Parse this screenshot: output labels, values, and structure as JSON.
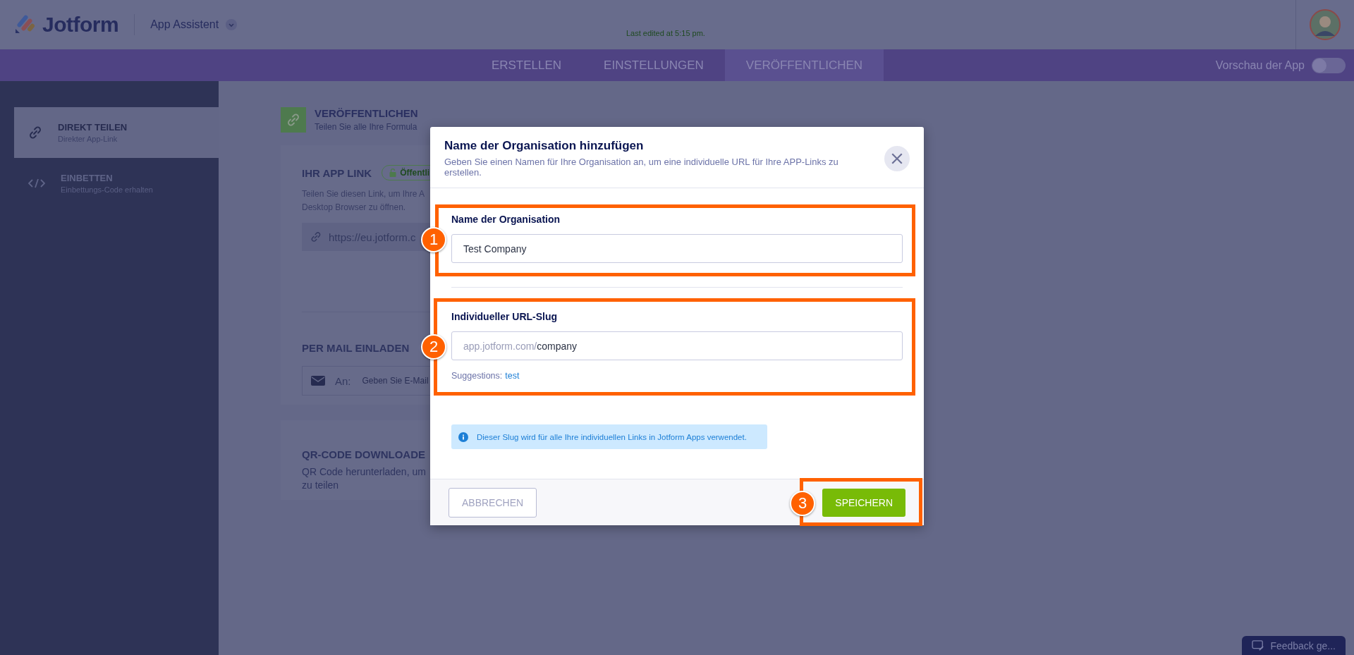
{
  "header": {
    "logo": "Jotform",
    "app_name": "App Assistent",
    "last_edited": "Last edited at 5:15 pm."
  },
  "nav": {
    "tabs": [
      {
        "label": "ERSTELLEN",
        "selected": false
      },
      {
        "label": "EINSTELLUNGEN",
        "selected": false
      },
      {
        "label": "VERÖFFENTLICHEN",
        "selected": true
      }
    ],
    "preview": {
      "label": "Vorschau der App",
      "on": false
    }
  },
  "sidebar": {
    "items": [
      {
        "kind": "link",
        "title": "DIREKT TEILEN",
        "subtitle": "Direkter App-Link",
        "selected": true
      },
      {
        "kind": "code",
        "title": "EINBETTEN",
        "subtitle": "Einbettungs-Code erhalten",
        "selected": false
      }
    ]
  },
  "main": {
    "title": "VERÖFFENTLICHEN",
    "subtitle": "Teilen Sie alle Ihre Formula",
    "app_link": {
      "heading": "IHR APP LINK",
      "badge": "Öffentli",
      "description": [
        "Teilen Sie diesen Link, um Ihre A",
        "Desktop Browser zu öffnen."
      ],
      "url": "https://eu.jotform.c"
    },
    "mail": {
      "heading": "PER MAIL EINLADEN",
      "to_label": "An:",
      "placeholder": "Geben Sie E-Mail"
    },
    "qr": {
      "heading": "QR-CODE DOWNLOADE",
      "description": [
        "QR Code herunterladen, um",
        "zu teilen"
      ]
    }
  },
  "modal": {
    "title": "Name der Organisation hinzufügen",
    "subtitle": "Geben Sie einen Namen für Ihre Organisation an, um eine individuelle URL für Ihre APP-Links zu erstellen.",
    "org_field": {
      "label": "Name der Organisation",
      "value": "Test Company"
    },
    "slug_field": {
      "label": "Individueller URL-Slug",
      "prefix": "app.jotform.com/",
      "value": "company",
      "suggestions_label": "Suggestions:",
      "suggestion": "test"
    },
    "info": "Dieser Slug wird für alle Ihre individuellen Links in Jotform Apps verwendet.",
    "cancel": "ABBRECHEN",
    "save": "SPEICHERN"
  },
  "annotations": [
    {
      "number": "1"
    },
    {
      "number": "2"
    },
    {
      "number": "3"
    }
  ],
  "feedback": "Feedback ge..."
}
